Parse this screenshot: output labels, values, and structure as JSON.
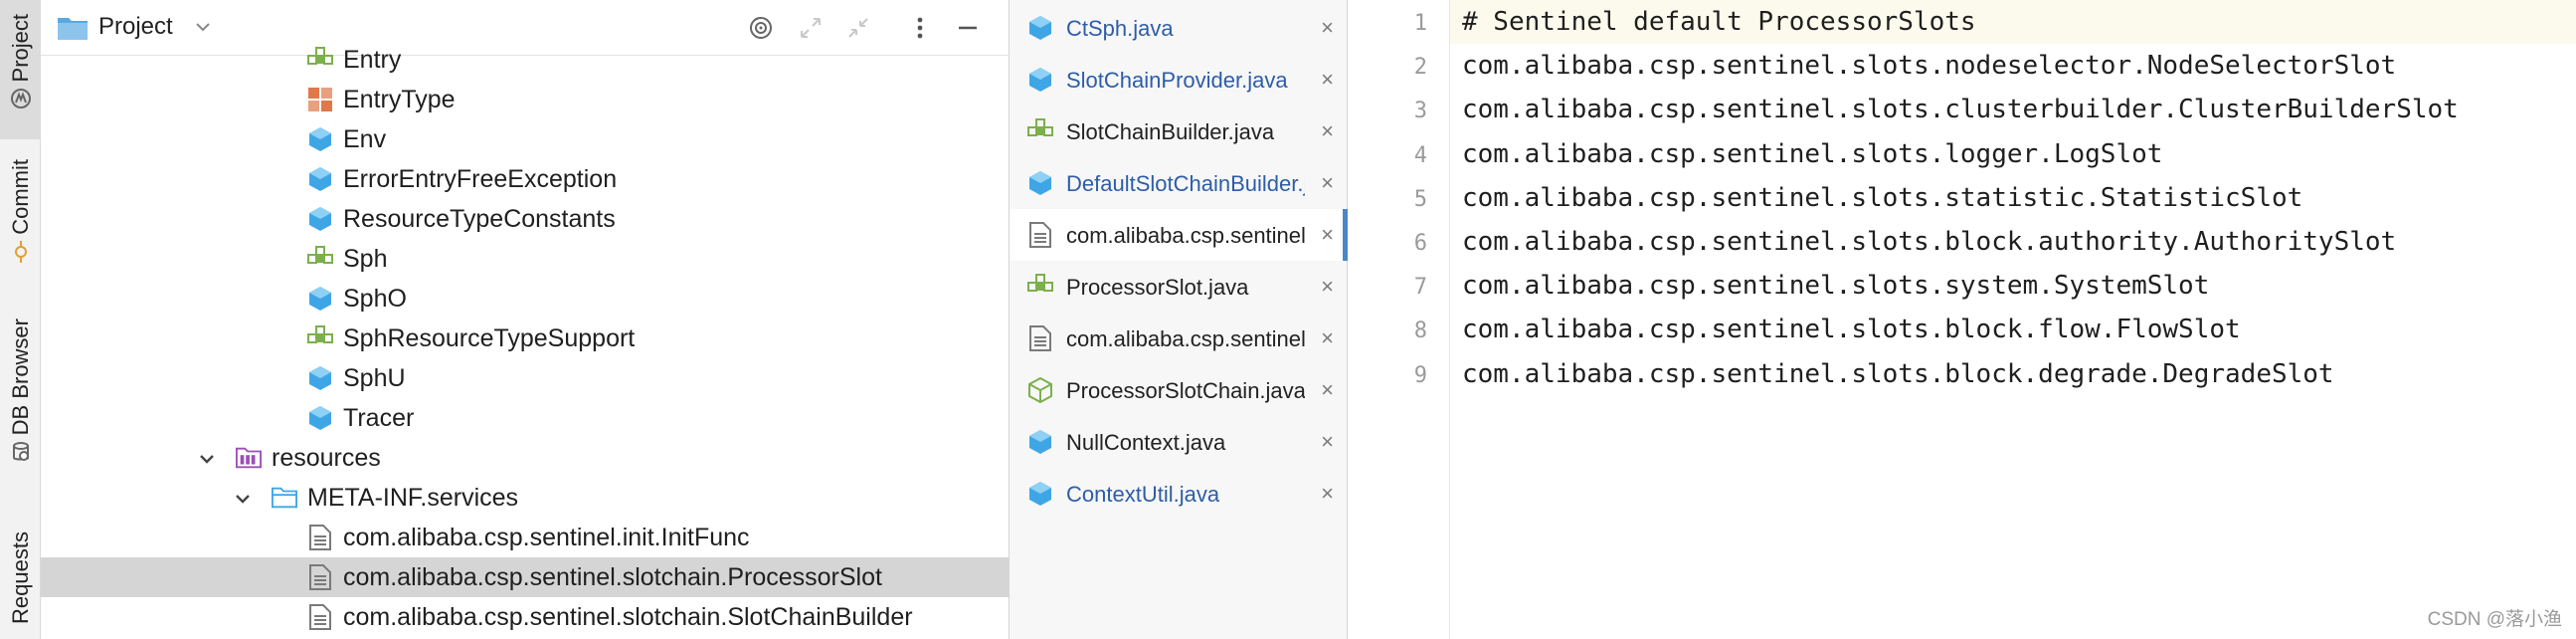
{
  "stripe": {
    "project": "Project",
    "commit": "Commit",
    "db_browser": "DB Browser",
    "requests": "Requests"
  },
  "project_panel": {
    "title": "Project",
    "tree": [
      {
        "label": "Entry",
        "icon": "interface-icon"
      },
      {
        "label": "EntryType",
        "icon": "enum-icon"
      },
      {
        "label": "Env",
        "icon": "class-icon"
      },
      {
        "label": "ErrorEntryFreeException",
        "icon": "class-icon"
      },
      {
        "label": "ResourceTypeConstants",
        "icon": "class-icon"
      },
      {
        "label": "Sph",
        "icon": "interface-icon"
      },
      {
        "label": "SphO",
        "icon": "class-icon"
      },
      {
        "label": "SphResourceTypeSupport",
        "icon": "interface-icon"
      },
      {
        "label": "SphU",
        "icon": "class-icon"
      },
      {
        "label": "Tracer",
        "icon": "class-icon"
      },
      {
        "label": "resources",
        "icon": "resources-folder-icon"
      },
      {
        "label": "META-INF.services",
        "icon": "folder-icon"
      },
      {
        "label": "com.alibaba.csp.sentinel.init.InitFunc",
        "icon": "file-icon"
      },
      {
        "label": "com.alibaba.csp.sentinel.slotchain.ProcessorSlot",
        "icon": "file-icon"
      },
      {
        "label": "com.alibaba.csp.sentinel.slotchain.SlotChainBuilder",
        "icon": "file-icon"
      }
    ]
  },
  "tabs": [
    {
      "label": "CtSph.java",
      "icon": "class-icon",
      "style": "blue"
    },
    {
      "label": "SlotChainProvider.java",
      "icon": "class-icon",
      "style": "blue"
    },
    {
      "label": "SlotChainBuilder.java",
      "icon": "interface-icon",
      "style": "dark"
    },
    {
      "label": "DefaultSlotChainBuilder.java",
      "icon": "class-icon",
      "style": "blue"
    },
    {
      "label": "com.alibaba.csp.sentinel.slotchain.ProcessorSlot",
      "icon": "file-icon",
      "style": "dark"
    },
    {
      "label": "ProcessorSlot.java",
      "icon": "interface-icon",
      "style": "dark"
    },
    {
      "label": "com.alibaba.csp.sentinel.slotchain.SlotChainBuilder",
      "icon": "file-icon",
      "style": "dark"
    },
    {
      "label": "ProcessorSlotChain.java",
      "icon": "abstract-class-icon",
      "style": "dark"
    },
    {
      "label": "NullContext.java",
      "icon": "class-icon",
      "style": "dark"
    },
    {
      "label": "ContextUtil.java",
      "icon": "class-icon",
      "style": "blue"
    }
  ],
  "tab_close": "×",
  "editor": {
    "line_numbers": [
      "1",
      "2",
      "3",
      "4",
      "5",
      "6",
      "7",
      "8",
      "9"
    ],
    "lines": [
      "# Sentinel default ProcessorSlots",
      "com.alibaba.csp.sentinel.slots.nodeselector.NodeSelectorSlot",
      "com.alibaba.csp.sentinel.slots.clusterbuilder.ClusterBuilderSlot",
      "com.alibaba.csp.sentinel.slots.logger.LogSlot",
      "com.alibaba.csp.sentinel.slots.statistic.StatisticSlot",
      "com.alibaba.csp.sentinel.slots.block.authority.AuthoritySlot",
      "com.alibaba.csp.sentinel.slots.system.SystemSlot",
      "com.alibaba.csp.sentinel.slots.block.flow.FlowSlot",
      "com.alibaba.csp.sentinel.slots.block.degrade.DegradeSlot"
    ]
  },
  "watermark": "CSDN @落小渔",
  "colors": {
    "class_icon": "#3fa6e6",
    "interface_icon": "#7bb04c",
    "enum_icon": "#e0784a",
    "resources_icon": "#9b4fb8",
    "folder_icon": "#3fa6e6",
    "tab_blue_text": "#2d5da8",
    "tab_marker": "#4a86c8"
  }
}
